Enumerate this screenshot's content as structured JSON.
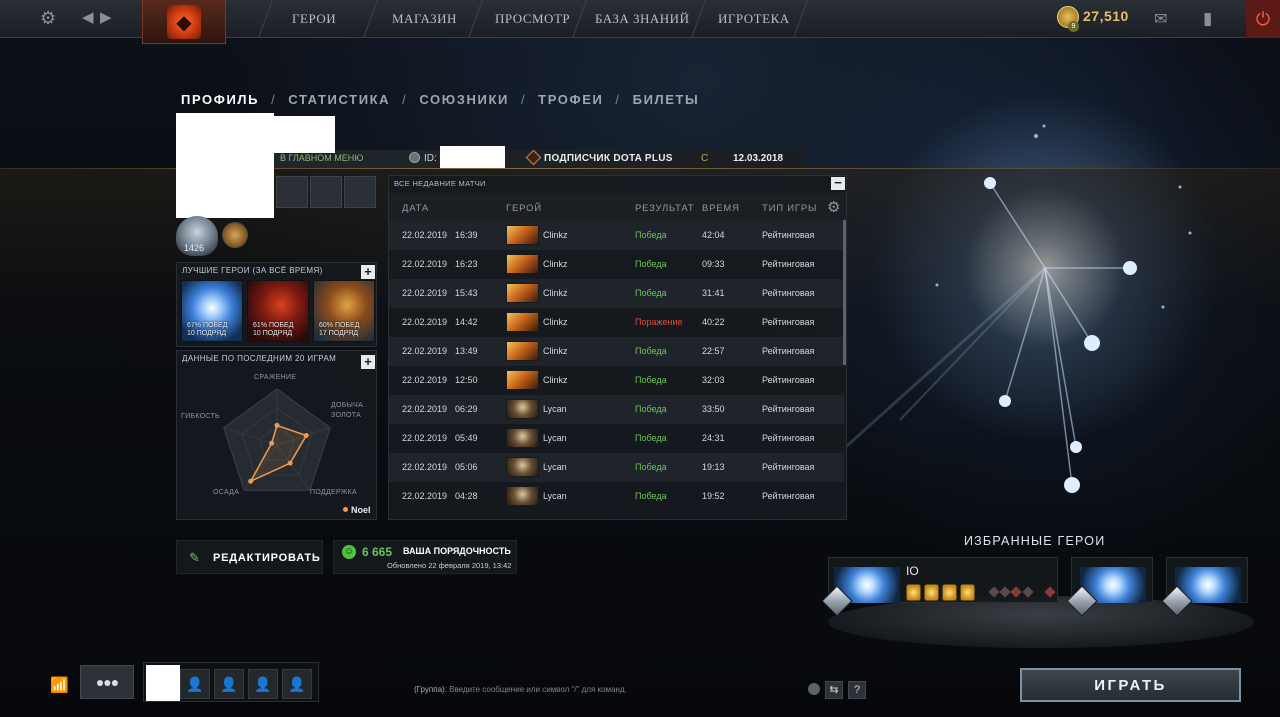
{
  "topbar": {
    "nav": [
      "ГЕРОИ",
      "МАГАЗИН",
      "ПРОСМОТР",
      "БАЗА ЗНАНИЙ",
      "ИГРОТЕКА"
    ],
    "currency": "27,510",
    "currency_badge": "9",
    "icons": {
      "settings": "gear-icon",
      "back": "arrow-left-icon",
      "forward": "arrow-right-icon",
      "mail": "mail-icon",
      "armory": "armory-icon",
      "power": "power-icon"
    }
  },
  "profile": {
    "tabs": [
      "ПРОФИЛЬ",
      "СТАТИСТИКА",
      "СОЮЗНИКИ",
      "ТРОФЕИ",
      "БИЛЕТЫ"
    ],
    "active_tab": "ПРОФИЛЬ",
    "status": "В ГЛАВНОМ МЕНЮ",
    "id_label": "ID:",
    "dota_plus": "ПОДПИСЧИК DOTA PLUS",
    "since_label": "С",
    "since_date": "12.03.2018",
    "medal_number": "1426"
  },
  "best_heroes": {
    "title": "ЛУЧШИЕ ГЕРОИ (ЗА ВСЁ ВРЕМЯ)",
    "heroes": [
      {
        "winrate": "67% ПОБЕД",
        "streak": "10 ПОДРЯД"
      },
      {
        "winrate": "61% ПОБЕД",
        "streak": "10 ПОДРЯД"
      },
      {
        "winrate": "60% ПОБЕД",
        "streak": "17 ПОДРЯД"
      }
    ]
  },
  "last20": {
    "title": "ДАННЫЕ ПО ПОСЛЕДНИМ 20 ИГРАМ",
    "axes": [
      "СРАЖЕНИЕ",
      "ДОБЫЧА ЗОЛОТА",
      "ПОДДЕРЖКА",
      "ОСАДА",
      "ГИБКОСТЬ"
    ],
    "axis_lines": {
      "farm_1": "ДОБЫЧА",
      "farm_2": "ЗОЛОТА"
    },
    "player": "Noel",
    "values": [
      0.35,
      0.55,
      0.4,
      0.8,
      0.1
    ],
    "color": "#f09a4e"
  },
  "matches": {
    "title": "ВСЕ НЕДАВНИЕ МАТЧИ",
    "columns": {
      "date": "ДАТА",
      "hero": "ГЕРОЙ",
      "result": "РЕЗУЛЬТАТ",
      "time": "ВРЕМЯ",
      "mode": "ТИП ИГРЫ"
    },
    "rows": [
      {
        "date": "22.02.2019",
        "time_of_day": "16:39",
        "hero": "Clinkz",
        "result": "Победа",
        "win": true,
        "duration": "42:04",
        "mode": "Рейтинговая"
      },
      {
        "date": "22.02.2019",
        "time_of_day": "16:23",
        "hero": "Clinkz",
        "result": "Победа",
        "win": true,
        "duration": "09:33",
        "mode": "Рейтинговая"
      },
      {
        "date": "22.02.2019",
        "time_of_day": "15:43",
        "hero": "Clinkz",
        "result": "Победа",
        "win": true,
        "duration": "31:41",
        "mode": "Рейтинговая"
      },
      {
        "date": "22.02.2019",
        "time_of_day": "14:42",
        "hero": "Clinkz",
        "result": "Поражение",
        "win": false,
        "duration": "40:22",
        "mode": "Рейтинговая"
      },
      {
        "date": "22.02.2019",
        "time_of_day": "13:49",
        "hero": "Clinkz",
        "result": "Победа",
        "win": true,
        "duration": "22:57",
        "mode": "Рейтинговая"
      },
      {
        "date": "22.02.2019",
        "time_of_day": "12:50",
        "hero": "Clinkz",
        "result": "Победа",
        "win": true,
        "duration": "32:03",
        "mode": "Рейтинговая"
      },
      {
        "date": "22.02.2019",
        "time_of_day": "06:29",
        "hero": "Lycan",
        "result": "Победа",
        "win": true,
        "duration": "33:50",
        "mode": "Рейтинговая"
      },
      {
        "date": "22.02.2019",
        "time_of_day": "05:49",
        "hero": "Lycan",
        "result": "Победа",
        "win": true,
        "duration": "24:31",
        "mode": "Рейтинговая"
      },
      {
        "date": "22.02.2019",
        "time_of_day": "05:06",
        "hero": "Lycan",
        "result": "Победа",
        "win": true,
        "duration": "19:13",
        "mode": "Рейтинговая"
      },
      {
        "date": "22.02.2019",
        "time_of_day": "04:28",
        "hero": "Lycan",
        "result": "Победа",
        "win": true,
        "duration": "19:52",
        "mode": "Рейтинговая"
      }
    ]
  },
  "actions": {
    "edit": "РЕДАКТИРОВАТЬ",
    "conduct_score": "6 665",
    "conduct_label": "ВАША ПОРЯДОЧНОСТЬ",
    "conduct_updated": "Обновлено 22 февраля 2019, 13:42"
  },
  "featured": {
    "title": "ИЗБРАННЫЕ ГЕРОИ",
    "main_hero": "IO"
  },
  "bottom": {
    "chat_channel": "(Группа):",
    "chat_placeholder": "Введите сообщение или символ \"/\" для команд.",
    "help": "?",
    "play": "ИГРАТЬ"
  },
  "colors": {
    "win": "#6fc35b",
    "loss": "#e34b3c",
    "accent_gold": "#e6c067",
    "conduct": "#6ac45b"
  }
}
